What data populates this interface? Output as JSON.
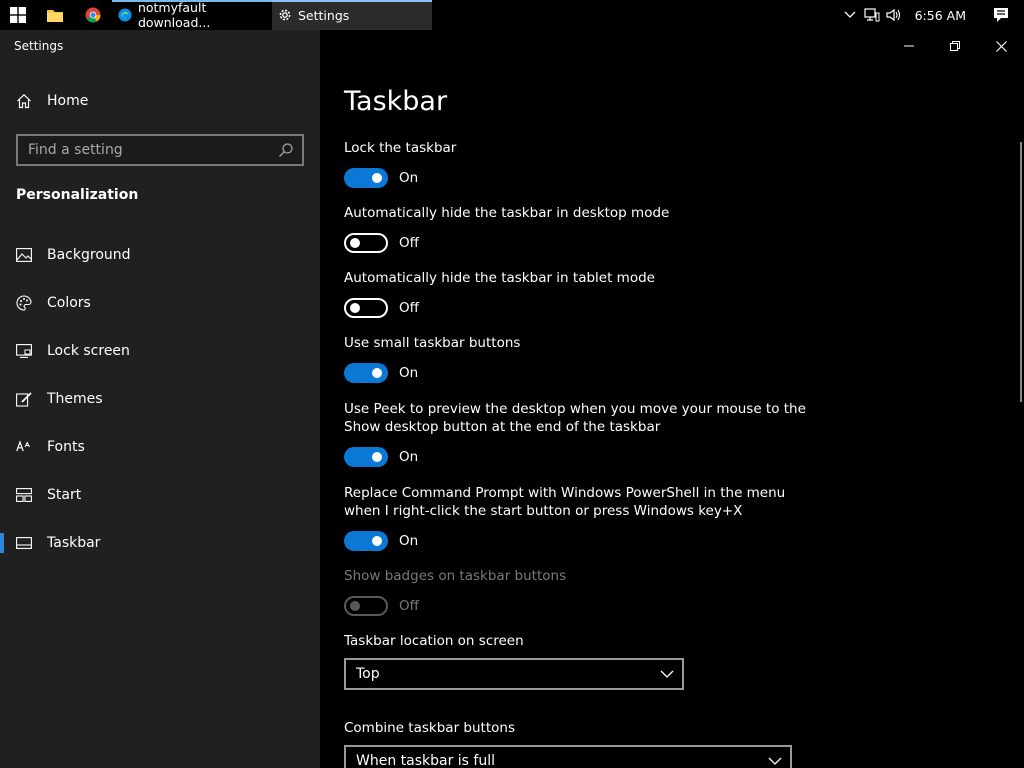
{
  "taskbar": {
    "tasks": [
      {
        "label": "notmyfault download..."
      },
      {
        "label": "Settings"
      }
    ],
    "clock": "6:56 AM"
  },
  "window": {
    "title": "Settings"
  },
  "sidebar": {
    "home_label": "Home",
    "search_placeholder": "Find a setting",
    "section_title": "Personalization",
    "items": [
      {
        "label": "Background",
        "icon": "image-icon"
      },
      {
        "label": "Colors",
        "icon": "palette-icon"
      },
      {
        "label": "Lock screen",
        "icon": "lock-screen-icon"
      },
      {
        "label": "Themes",
        "icon": "brush-icon"
      },
      {
        "label": "Fonts",
        "icon": "font-icon"
      },
      {
        "label": "Start",
        "icon": "start-icon"
      },
      {
        "label": "Taskbar",
        "icon": "taskbar-icon",
        "active": true
      }
    ]
  },
  "main": {
    "title": "Taskbar",
    "settings": [
      {
        "label": "Lock the taskbar",
        "state": "On"
      },
      {
        "label": "Automatically hide the taskbar in desktop mode",
        "state": "Off"
      },
      {
        "label": "Automatically hide the taskbar in tablet mode",
        "state": "Off"
      },
      {
        "label": "Use small taskbar buttons",
        "state": "On"
      },
      {
        "label_line1": "Use Peek to preview the desktop when you move your mouse to the",
        "label_line2": "Show desktop button at the end of the taskbar",
        "state": "On"
      },
      {
        "label_line1": "Replace Command Prompt with Windows PowerShell in the menu",
        "label_line2": "when I right-click the start button or press Windows key+X",
        "state": "On"
      },
      {
        "label": "Show badges on taskbar buttons",
        "state": "Off",
        "disabled": true
      }
    ],
    "location": {
      "label": "Taskbar location on screen",
      "value": "Top"
    },
    "combine": {
      "label": "Combine taskbar buttons",
      "value": "When taskbar is full"
    }
  },
  "colors": {
    "accent": "#0a78d4",
    "sidebar_bg": "#202020",
    "main_bg": "#000000"
  }
}
